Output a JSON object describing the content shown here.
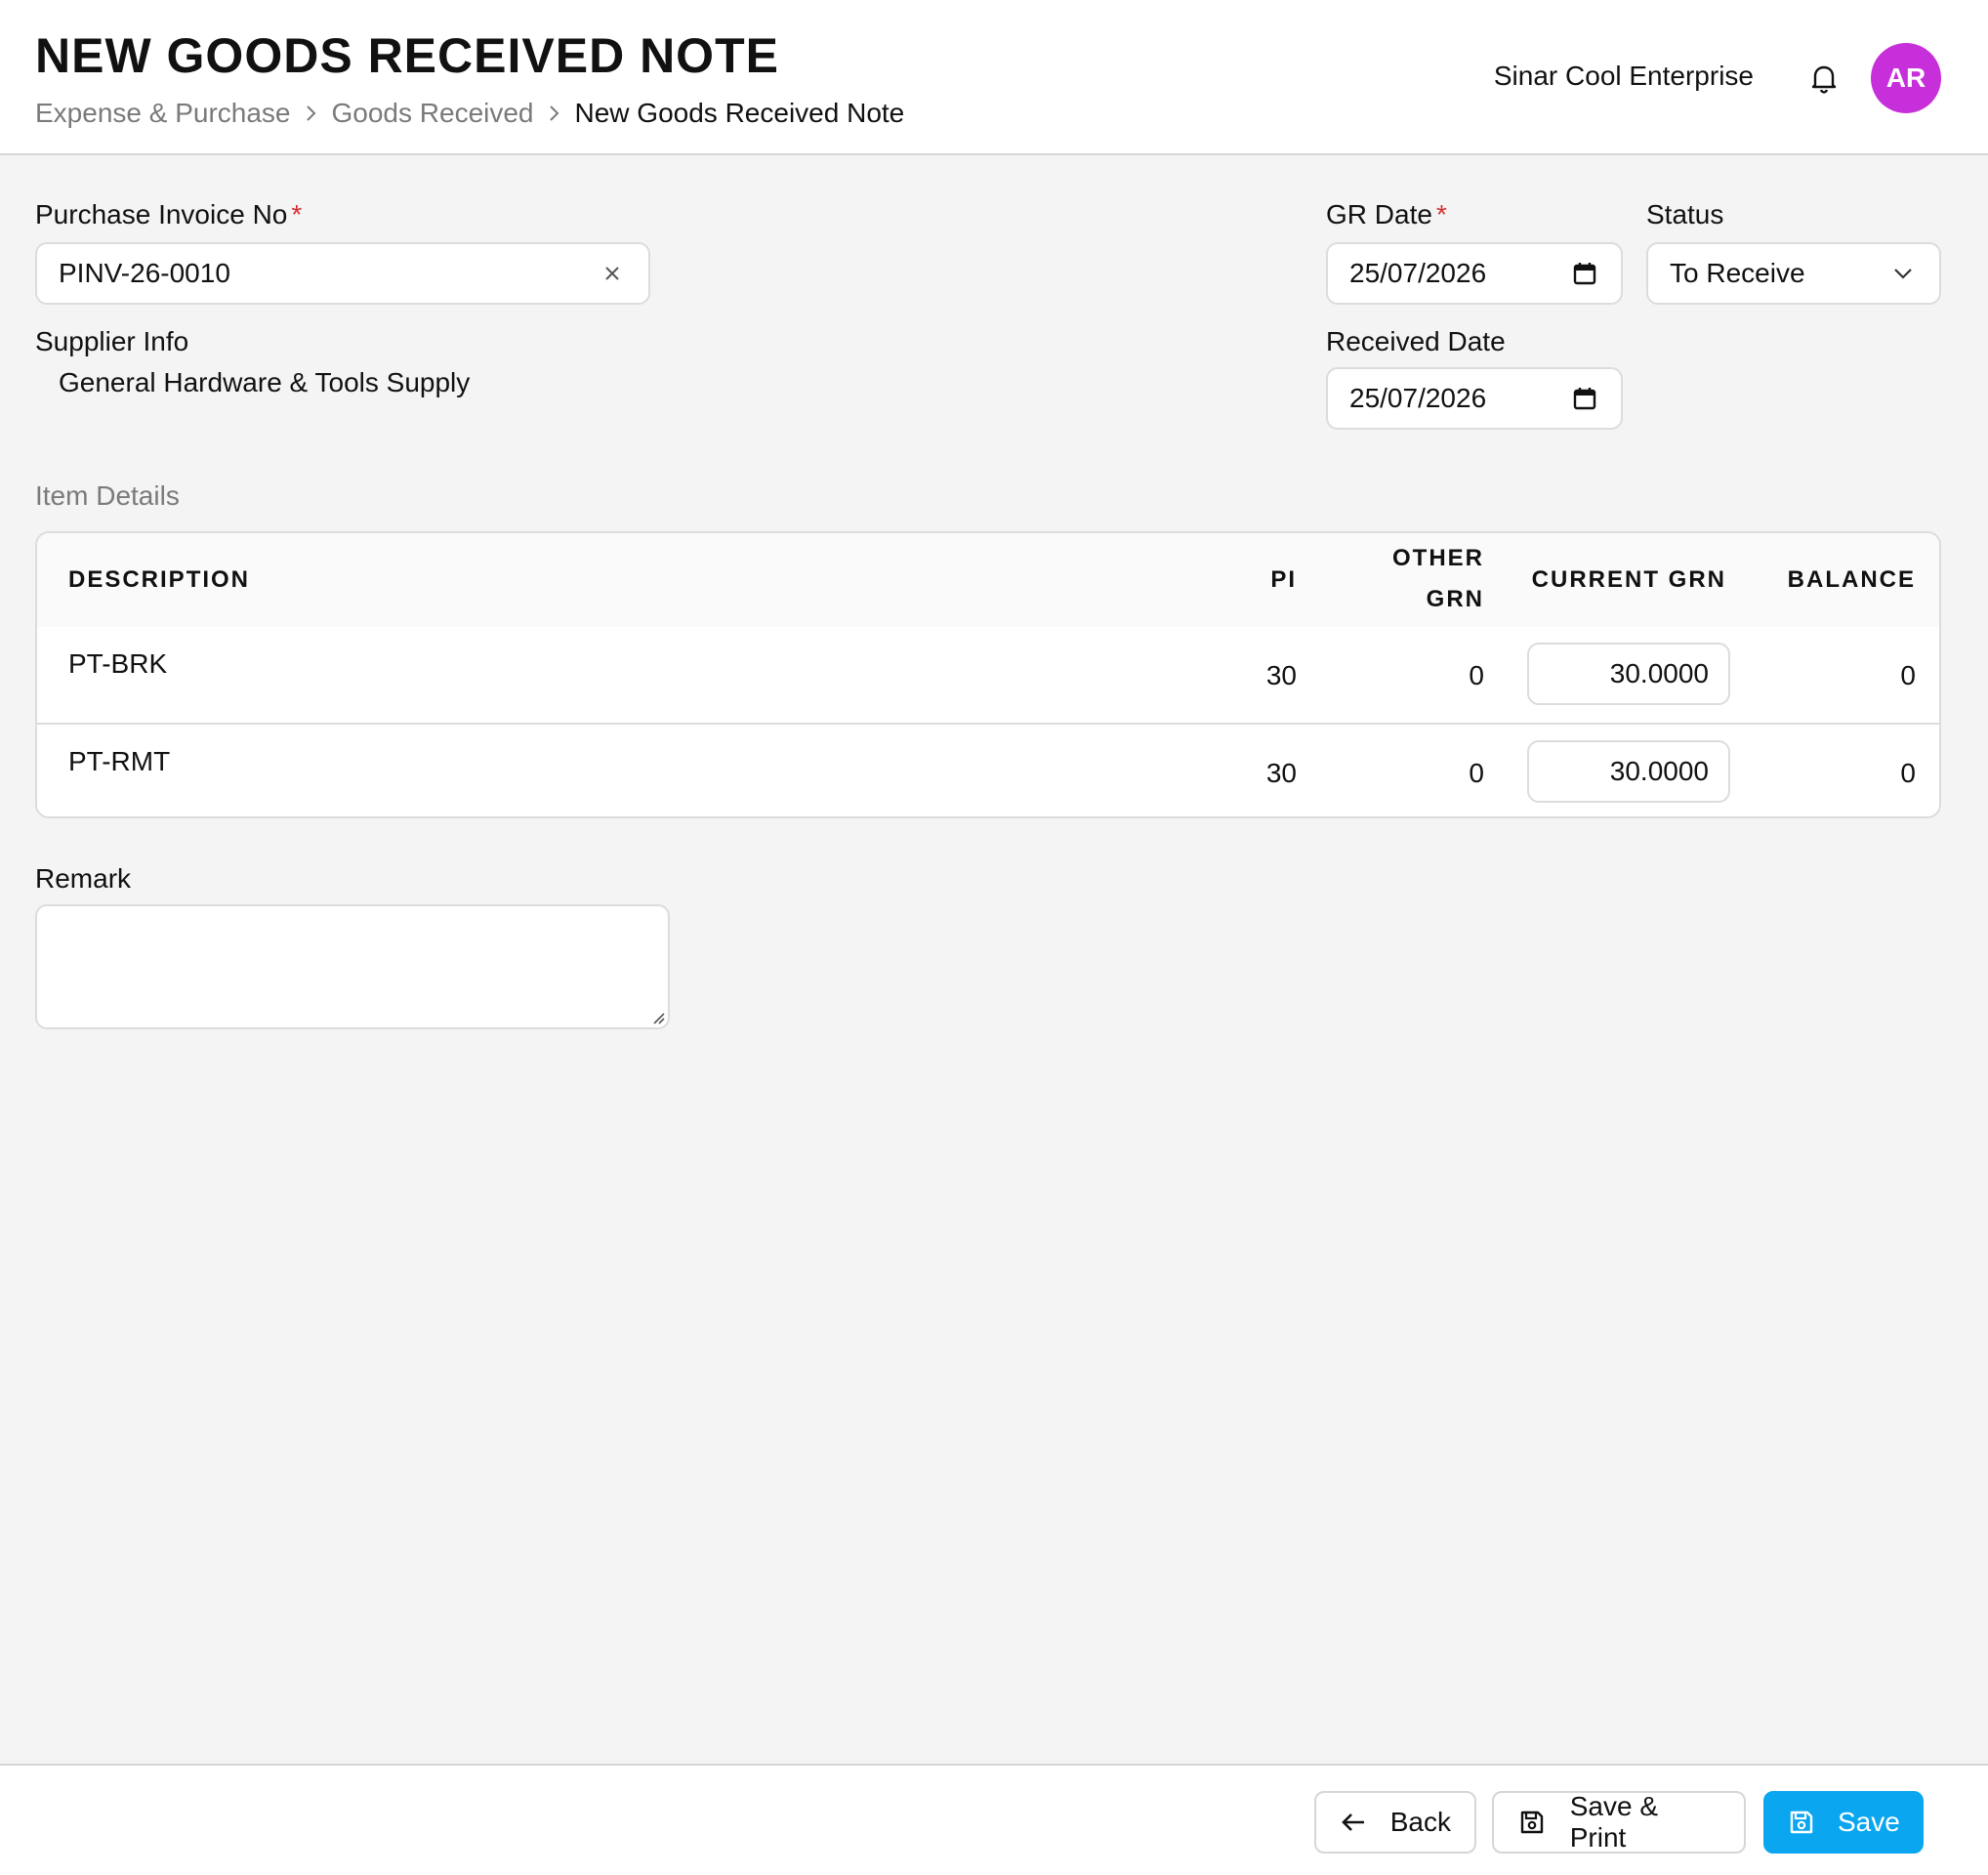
{
  "header": {
    "title": "NEW GOODS RECEIVED NOTE",
    "breadcrumb": [
      "Expense & Purchase",
      "Goods Received",
      "New Goods Received Note"
    ],
    "company": "Sinar Cool Enterprise",
    "avatar_initials": "AR",
    "avatar_color": "#c62fd9"
  },
  "form": {
    "purchase_invoice_label": "Purchase Invoice No",
    "purchase_invoice_value": "PINV-26-0010",
    "required_mark": "*",
    "supplier_info_label": "Supplier Info",
    "supplier_info_value": "General Hardware & Tools Supply",
    "gr_date_label": "GR Date",
    "gr_date_value": "25/07/2026",
    "status_label": "Status",
    "status_value": "To Receive",
    "received_date_label": "Received Date",
    "received_date_value": "25/07/2026"
  },
  "items": {
    "section_title": "Item Details",
    "columns": {
      "description": "DESCRIPTION",
      "pi": "PI",
      "other_grn_line1": "OTHER",
      "other_grn_line2": "GRN",
      "current_grn": "CURRENT GRN",
      "balance": "BALANCE"
    },
    "rows": [
      {
        "description": "PT-BRK",
        "pi": "30",
        "other_grn": "0",
        "current_grn": "30.0000",
        "balance": "0"
      },
      {
        "description": "PT-RMT",
        "pi": "30",
        "other_grn": "0",
        "current_grn": "30.0000",
        "balance": "0"
      }
    ]
  },
  "remark": {
    "label": "Remark",
    "value": ""
  },
  "footer": {
    "back_label": "Back",
    "save_print_label": "Save & Print",
    "save_label": "Save",
    "primary_color": "#0aa6f0"
  }
}
